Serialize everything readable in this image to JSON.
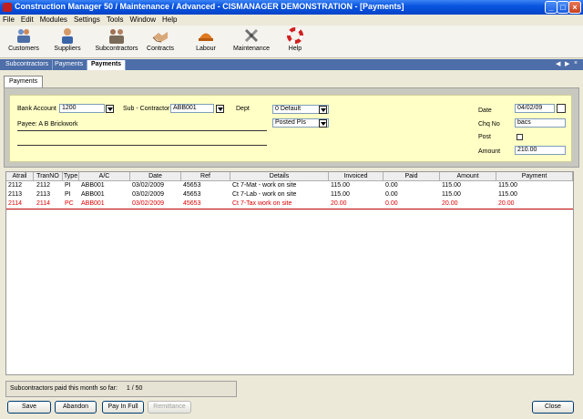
{
  "window": {
    "title": "Construction Manager 50 / Maintenance / Advanced  -  CISMANAGER  DEMONSTRATION  -  [Payments]"
  },
  "menu": [
    "File",
    "Edit",
    "Modules",
    "Settings",
    "Tools",
    "Window",
    "Help"
  ],
  "toolbar": [
    {
      "label": "Customers",
      "icon": "customers-icon"
    },
    {
      "label": "Suppliers",
      "icon": "suppliers-icon"
    },
    {
      "label": "Subcontractors",
      "icon": "subcontractors-icon"
    },
    {
      "label": "Contracts",
      "icon": "contracts-icon"
    },
    {
      "label": "Labour",
      "icon": "labour-icon"
    },
    {
      "label": "Maintenance",
      "icon": "maintenance-icon"
    },
    {
      "label": "Help",
      "icon": "help-icon"
    }
  ],
  "tabs": [
    "Subcontractors",
    "Payments",
    "Payments"
  ],
  "subtab": "Payments",
  "form": {
    "bank_label": "Bank Account",
    "bank_value": "1200",
    "sub_label": "Sub - Contractor",
    "sub_value": "ABB001",
    "dept_label": "Dept",
    "dept_value": "0  Default",
    "posted_value": "Posted PIs",
    "payee": "Payee: A B Brickwork",
    "date_label": "Date",
    "date_value": "04/02/09",
    "chq_label": "Chq No",
    "chq_value": "bacs",
    "post_label": "Post",
    "amount_label": "Amount",
    "amount_value": "210.00"
  },
  "grid": {
    "columns": [
      "Atrail",
      "TranNO",
      "Type",
      "A/C",
      "Date",
      "Ref",
      "Details",
      "Invoiced",
      "Paid",
      "Amount",
      "Payment"
    ],
    "rows": [
      [
        "2112",
        "2112",
        "PI",
        "ABB001",
        "03/02/2009",
        "45653",
        "Ct 7-Mat  - work on site",
        "115.00",
        "0.00",
        "115.00",
        "115.00"
      ],
      [
        "2113",
        "2113",
        "PI",
        "ABB001",
        "03/02/2009",
        "45653",
        "Ct 7-Lab  - work on site",
        "115.00",
        "0.00",
        "115.00",
        "115.00"
      ],
      [
        "2114",
        "2114",
        "PC",
        "ABB001",
        "03/02/2009",
        "45653",
        "Ct 7-Tax work on site",
        "20.00",
        "0.00",
        "20.00",
        "20.00"
      ]
    ]
  },
  "status": {
    "label": "Subcontractors paid this month so far:",
    "value": "1 / 50"
  },
  "buttons": {
    "save": "Save",
    "abandon": "Abandon",
    "payinfull": "Pay In Full",
    "remittance": "Remittance",
    "close": "Close"
  },
  "colors": {
    "titlebar": "#0a55e0",
    "form_bg": "#ffffc6",
    "highlight_row": "#e00000",
    "tabstrip": "#4d6ea8"
  }
}
